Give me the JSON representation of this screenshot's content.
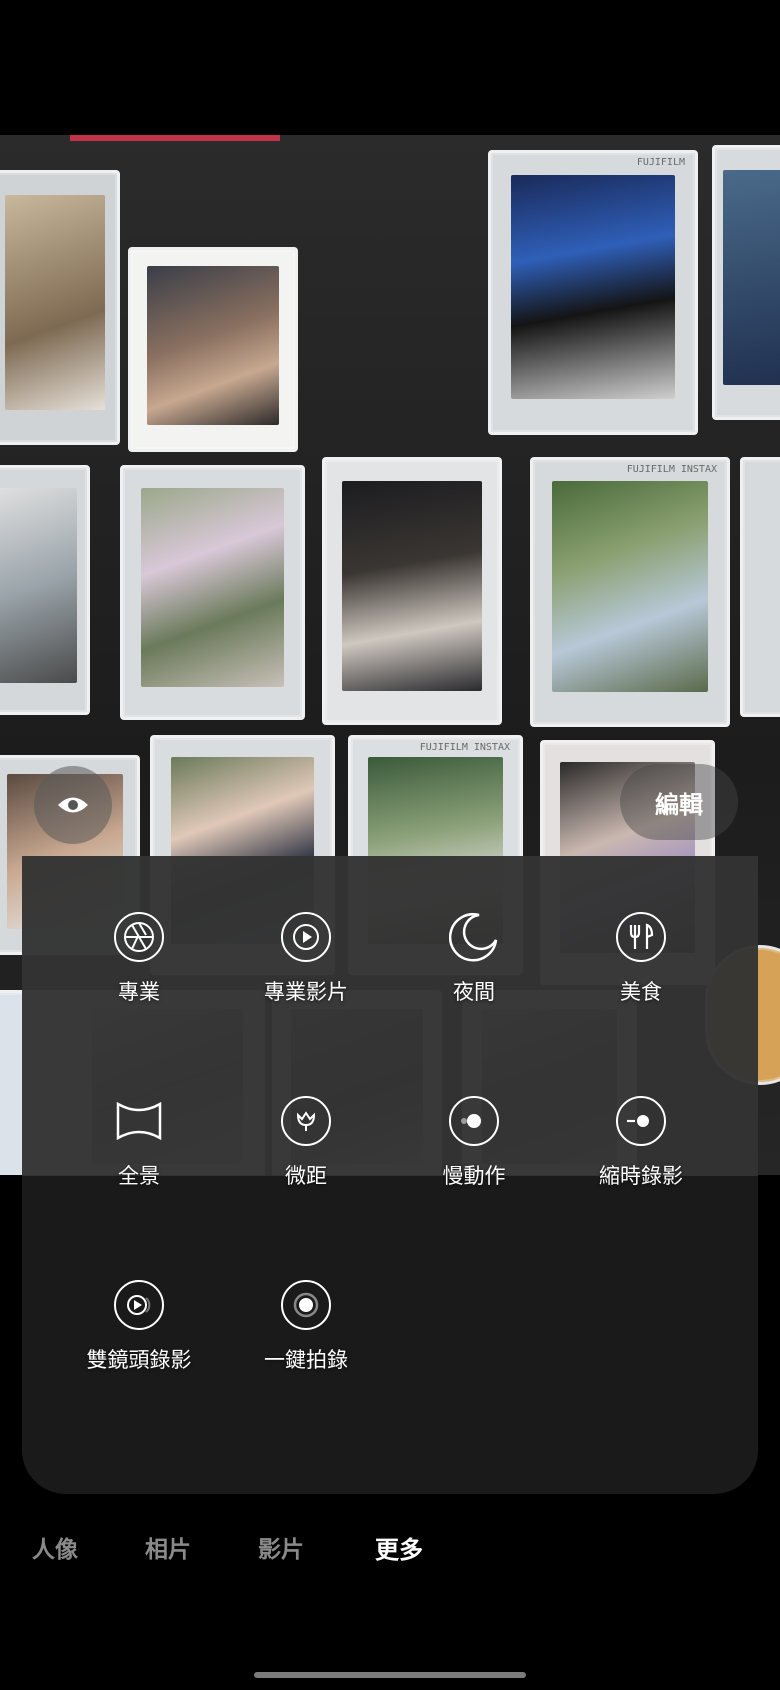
{
  "controls": {
    "edit_label": "編輯"
  },
  "modes": [
    {
      "label": "專業",
      "icon": "aperture-icon"
    },
    {
      "label": "專業影片",
      "icon": "pro-video-play-icon"
    },
    {
      "label": "夜間",
      "icon": "moon-icon"
    },
    {
      "label": "美食",
      "icon": "fork-knife-icon"
    },
    {
      "label": "全景",
      "icon": "panorama-icon"
    },
    {
      "label": "微距",
      "icon": "macro-flower-icon"
    },
    {
      "label": "慢動作",
      "icon": "slow-motion-icon"
    },
    {
      "label": "縮時錄影",
      "icon": "hyperlapse-icon"
    },
    {
      "label": "雙鏡頭錄影",
      "icon": "dual-recording-icon"
    },
    {
      "label": "一鍵拍錄",
      "icon": "single-take-icon"
    }
  ],
  "tabs": [
    {
      "label": "人像",
      "active": false
    },
    {
      "label": "相片",
      "active": false
    },
    {
      "label": "影片",
      "active": false
    },
    {
      "label": "更多",
      "active": true
    }
  ]
}
